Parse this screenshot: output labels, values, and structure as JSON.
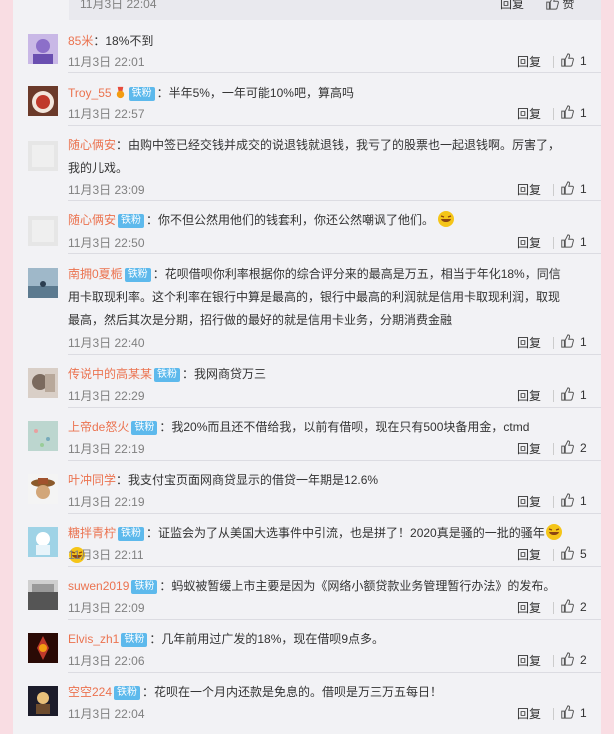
{
  "top_strip": {
    "time": "11月3日 22:04",
    "reply_label": "回复",
    "like_label": "赞"
  },
  "labels": {
    "reply": "回复",
    "badge": "铁粉"
  },
  "comments": [
    {
      "user": "85米",
      "text": "：18%不到",
      "time": "11月3日 22:01",
      "likes": "1",
      "badge": false
    },
    {
      "user": "Troy_55",
      "text": "：半年5%，一年可能10%吧，算高吗",
      "time": "11月3日 22:57",
      "likes": "1",
      "badge": true
    },
    {
      "user": "随心俩安",
      "text": "：由购中签已经交钱并成交的说退钱就退钱，我亏了的股票也一起退钱啊。厉害了，我的儿戏。",
      "time": "11月3日 23:09",
      "likes": "1",
      "badge": false
    },
    {
      "user": "随心俩安",
      "text": "：你不但公然用他们的钱套利，你还公然嘲讽了他们。",
      "time": "11月3日 22:50",
      "likes": "1",
      "badge": true
    },
    {
      "user": "南拥0夏栀",
      "text": "：花呗借呗你利率根据你的综合评分来的最高是万五，相当于年化18%，同信用卡取现利率。这个利率在银行中算是最高的，银行中最高的利润就是信用卡取现利润，取现最高，然后其次是分期，招行做的最好的就是信用卡业务，分期消费金融",
      "time": "11月3日 22:40",
      "likes": "1",
      "badge": true
    },
    {
      "user": "传说中的高某某",
      "text": "：我网商贷万三",
      "time": "11月3日 22:29",
      "likes": "1",
      "badge": true
    },
    {
      "user": "上帝de怒火",
      "text": "：我20%而且还不借给我，以前有借呗，现在只有500块备用金，ctmd",
      "time": "11月3日 22:19",
      "likes": "2",
      "badge": true
    },
    {
      "user": "叶冲同学",
      "text": "：我支付宝页面网商贷显示的借贷一年期是12.6%",
      "time": "11月3日 22:19",
      "likes": "1",
      "badge": false
    },
    {
      "user": "糖拌青柠",
      "text": "：证监会为了从美国大选事件中引流，也是拼了！2020真是骚的一批的骚年",
      "time": "11月3日 22:11",
      "likes": "5",
      "badge": true
    },
    {
      "user": "suwen2019",
      "text": "：蚂蚁被暂缓上市主要是因为《网络小额贷款业务管理暂行办法》的发布。",
      "time": "11月3日 22:09",
      "likes": "2",
      "badge": true
    },
    {
      "user": "Elvis_zh1",
      "text": "：几年前用过广发的18%，现在借呗9点多。",
      "time": "11月3日 22:06",
      "likes": "2",
      "badge": true
    },
    {
      "user": "空空224",
      "text": "：花呗在一个月内还款是免息的。借呗是万三万五每日！",
      "time": "11月3日 22:04",
      "likes": "1",
      "badge": true
    }
  ],
  "icons": {
    "like": "thumbs-up-icon",
    "medal": "fan-medal-icon",
    "emoji": "laughing-emoji-icon"
  },
  "colors": {
    "page_bg": "#f9dde3",
    "panel_bg": "#f2f2f5",
    "username": "#eb7350",
    "badge": "#5db9ec",
    "time": "#808080"
  }
}
